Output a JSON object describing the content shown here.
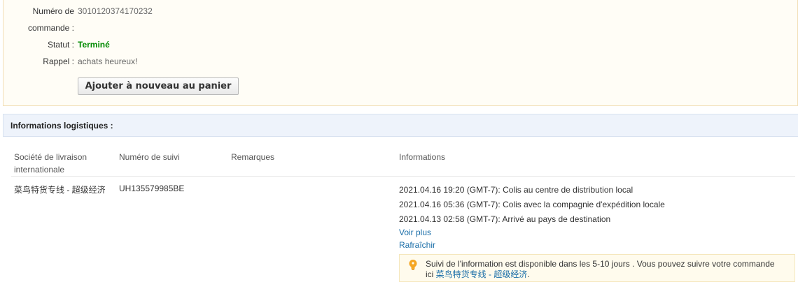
{
  "order": {
    "order_number_label_line1": "Numéro de",
    "order_number_label_line2": "commande :",
    "order_number": "3010120374170232",
    "status_label": "Statut :",
    "status": "Terminé",
    "reminder_label": "Rappel :",
    "reminder": "achats heureux!",
    "add_to_cart_button": "Ajouter à nouveau au panier"
  },
  "logistics": {
    "header": "Informations logistiques :",
    "columns": {
      "company_line1": "Société de livraison",
      "company_line2": "internationale",
      "tracking_number": "Numéro de suivi",
      "remarks": "Remarques",
      "information": "Informations"
    },
    "row": {
      "company": "菜鸟特货专线 - 超级经济",
      "tracking_number": "UH135579985BE",
      "remarks": "",
      "events": [
        "2021.04.16 19:20 (GMT-7): Colis au centre de distribution local",
        "2021.04.16 05:36 (GMT-7): Colis avec la compagnie d'expédition locale",
        "2021.04.13 02:58 (GMT-7): Arrivé au pays de destination"
      ],
      "see_more": "Voir plus",
      "refresh": "Rafraîchir"
    },
    "notice": {
      "icon": "lightbulb-icon",
      "text_line1": "Suivi de l'information est disponible dans les 5-10 jours . Vous pouvez suivre votre commande",
      "text_line2_prefix": "ici ",
      "link": "菜鸟特货专线 - 超级经济",
      "text_line2_suffix": "."
    }
  },
  "colors": {
    "status_green": "#008a00",
    "link_blue": "#1a6ea8",
    "header_bg": "#eef3fb",
    "notice_bg": "#fffbed"
  }
}
